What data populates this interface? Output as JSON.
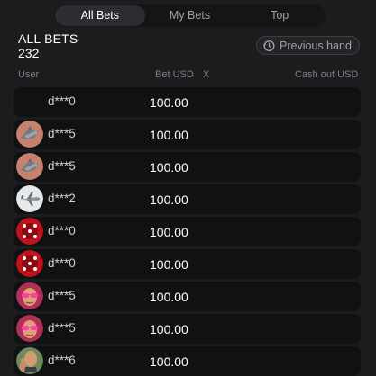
{
  "tabs": [
    "All Bets",
    "My Bets",
    "Top"
  ],
  "header": {
    "title": "ALL BETS",
    "count": "232",
    "previous_hand": "Previous hand"
  },
  "columns": {
    "user": "User",
    "bet": "Bet USD",
    "x": "X",
    "cashout": "Cash out USD"
  },
  "rows": [
    {
      "user": "d***0",
      "bet": "100.00",
      "avatar": "none"
    },
    {
      "user": "d***5",
      "bet": "100.00",
      "avatar": "jet-avatar"
    },
    {
      "user": "d***5",
      "bet": "100.00",
      "avatar": "jet-avatar"
    },
    {
      "user": "d***2",
      "bet": "100.00",
      "avatar": "plane-avatar"
    },
    {
      "user": "d***0",
      "bet": "100.00",
      "avatar": "dice-avatar"
    },
    {
      "user": "d***0",
      "bet": "100.00",
      "avatar": "dice-avatar"
    },
    {
      "user": "d***5",
      "bet": "100.00",
      "avatar": "sunglasses-man-avatar"
    },
    {
      "user": "d***5",
      "bet": "100.00",
      "avatar": "sunglasses-man-avatar"
    },
    {
      "user": "d***6",
      "bet": "100.00",
      "avatar": "thumbs-up-man-avatar"
    }
  ]
}
